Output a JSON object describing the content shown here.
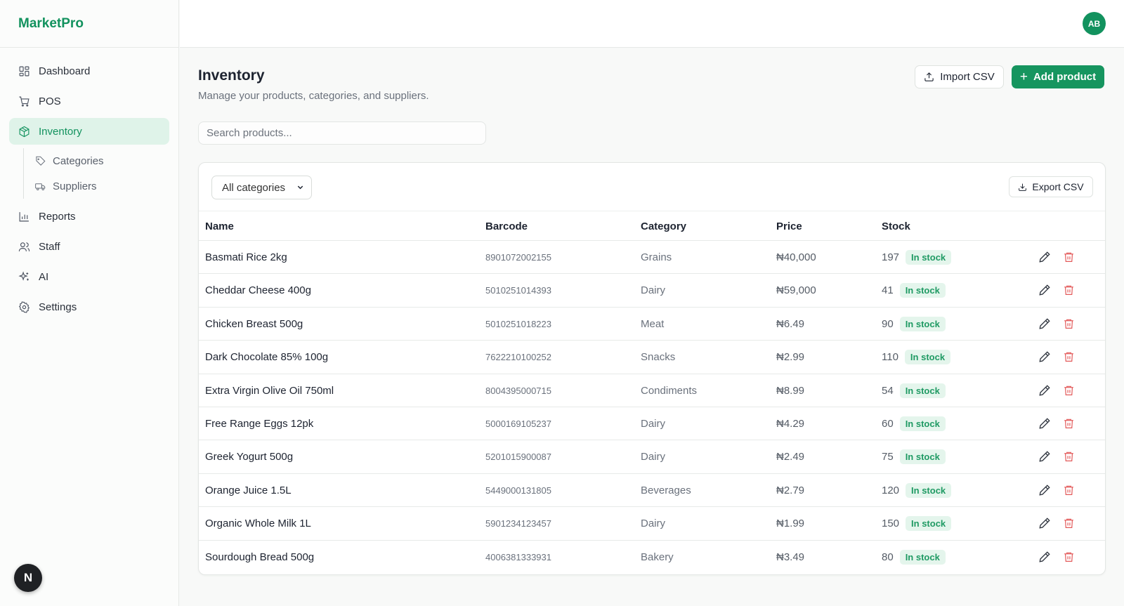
{
  "brand": "MarketPro",
  "user": {
    "initials": "AB"
  },
  "sidebar": {
    "items": [
      {
        "label": "Dashboard",
        "icon": "dashboard-icon"
      },
      {
        "label": "POS",
        "icon": "cart-icon"
      },
      {
        "label": "Inventory",
        "icon": "box-icon",
        "active": true
      },
      {
        "label": "Reports",
        "icon": "bar-chart-icon"
      },
      {
        "label": "Staff",
        "icon": "users-icon"
      },
      {
        "label": "AI",
        "icon": "sparkles-icon"
      },
      {
        "label": "Settings",
        "icon": "gear-icon"
      }
    ],
    "subitems": [
      {
        "label": "Categories",
        "icon": "tag-icon"
      },
      {
        "label": "Suppliers",
        "icon": "truck-icon"
      }
    ],
    "badge": "N"
  },
  "page": {
    "title": "Inventory",
    "subtitle": "Manage your products, categories, and suppliers.",
    "import_label": "Import CSV",
    "add_label": "Add product",
    "search_placeholder": "Search products..."
  },
  "table": {
    "filter_value": "All categories",
    "export_label": "Export CSV",
    "headers": {
      "name": "Name",
      "barcode": "Barcode",
      "category": "Category",
      "price": "Price",
      "stock": "Stock"
    },
    "rows": [
      {
        "name": "Basmati Rice 2kg",
        "barcode": "8901072002155",
        "category": "Grains",
        "price": "₦40,000",
        "stock": "197",
        "status": "In stock"
      },
      {
        "name": "Cheddar Cheese 400g",
        "barcode": "5010251014393",
        "category": "Dairy",
        "price": "₦59,000",
        "stock": "41",
        "status": "In stock"
      },
      {
        "name": "Chicken Breast 500g",
        "barcode": "5010251018223",
        "category": "Meat",
        "price": "₦6.49",
        "stock": "90",
        "status": "In stock"
      },
      {
        "name": "Dark Chocolate 85% 100g",
        "barcode": "7622210100252",
        "category": "Snacks",
        "price": "₦2.99",
        "stock": "110",
        "status": "In stock"
      },
      {
        "name": "Extra Virgin Olive Oil 750ml",
        "barcode": "8004395000715",
        "category": "Condiments",
        "price": "₦8.99",
        "stock": "54",
        "status": "In stock"
      },
      {
        "name": "Free Range Eggs 12pk",
        "barcode": "5000169105237",
        "category": "Dairy",
        "price": "₦4.29",
        "stock": "60",
        "status": "In stock"
      },
      {
        "name": "Greek Yogurt 500g",
        "barcode": "5201015900087",
        "category": "Dairy",
        "price": "₦2.49",
        "stock": "75",
        "status": "In stock"
      },
      {
        "name": "Orange Juice 1.5L",
        "barcode": "5449000131805",
        "category": "Beverages",
        "price": "₦2.79",
        "stock": "120",
        "status": "In stock"
      },
      {
        "name": "Organic Whole Milk 1L",
        "barcode": "5901234123457",
        "category": "Dairy",
        "price": "₦1.99",
        "stock": "150",
        "status": "In stock"
      },
      {
        "name": "Sourdough Bread 500g",
        "barcode": "4006381333931",
        "category": "Bakery",
        "price": "₦3.49",
        "stock": "80",
        "status": "In stock"
      }
    ]
  },
  "colors": {
    "accent": "#16955f",
    "badge_bg": "#e4f5ec",
    "danger": "#e35a5a"
  }
}
